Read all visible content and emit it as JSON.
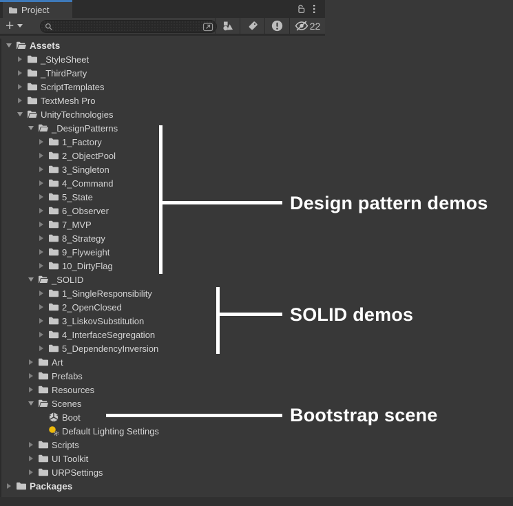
{
  "panel": {
    "tab": {
      "label": "Project",
      "icon": "folder-icon"
    },
    "window_controls": {
      "lock": {
        "icon": "unlocked-padlock-icon",
        "state": "unlocked"
      },
      "menu": {
        "icon": "kebab-menu-icon"
      }
    },
    "toolbar": {
      "create_button_label": "+",
      "search": {
        "value": "",
        "placeholder": "",
        "icon": "search-icon",
        "popout_icon": "open-in-window-icon"
      },
      "filters": [
        {
          "name": "search-by-type",
          "icon": "shapes-icon"
        },
        {
          "name": "search-by-label",
          "icon": "tag-icon"
        },
        {
          "name": "search-by-import-warnings",
          "icon": "exclamation-circle-icon"
        }
      ],
      "hidden_items": {
        "icon": "eye-slash-icon",
        "count": "22"
      }
    }
  },
  "tree": {
    "items": [
      {
        "label": "Assets",
        "level": 0,
        "expander": "expanded",
        "icon": "folder-open-icon",
        "bold": true
      },
      {
        "label": "_StyleSheet",
        "level": 1,
        "expander": "collapsed",
        "icon": "folder-icon"
      },
      {
        "label": "_ThirdParty",
        "level": 1,
        "expander": "collapsed",
        "icon": "folder-icon"
      },
      {
        "label": "ScriptTemplates",
        "level": 1,
        "expander": "collapsed",
        "icon": "folder-icon"
      },
      {
        "label": "TextMesh Pro",
        "level": 1,
        "expander": "collapsed",
        "icon": "folder-icon"
      },
      {
        "label": "UnityTechnologies",
        "level": 1,
        "expander": "expanded",
        "icon": "folder-open-icon"
      },
      {
        "label": "_DesignPatterns",
        "level": 2,
        "expander": "expanded",
        "icon": "folder-open-icon"
      },
      {
        "label": "1_Factory",
        "level": 3,
        "expander": "collapsed",
        "icon": "folder-icon"
      },
      {
        "label": "2_ObjectPool",
        "level": 3,
        "expander": "collapsed",
        "icon": "folder-icon"
      },
      {
        "label": "3_Singleton",
        "level": 3,
        "expander": "collapsed",
        "icon": "folder-icon"
      },
      {
        "label": "4_Command",
        "level": 3,
        "expander": "collapsed",
        "icon": "folder-icon"
      },
      {
        "label": "5_State",
        "level": 3,
        "expander": "collapsed",
        "icon": "folder-icon"
      },
      {
        "label": "6_Observer",
        "level": 3,
        "expander": "collapsed",
        "icon": "folder-icon"
      },
      {
        "label": "7_MVP",
        "level": 3,
        "expander": "collapsed",
        "icon": "folder-icon"
      },
      {
        "label": "8_Strategy",
        "level": 3,
        "expander": "collapsed",
        "icon": "folder-icon"
      },
      {
        "label": "9_Flyweight",
        "level": 3,
        "expander": "collapsed",
        "icon": "folder-icon"
      },
      {
        "label": "10_DirtyFlag",
        "level": 3,
        "expander": "collapsed",
        "icon": "folder-icon"
      },
      {
        "label": "_SOLID",
        "level": 2,
        "expander": "expanded",
        "icon": "folder-open-icon"
      },
      {
        "label": "1_SingleResponsibility",
        "level": 3,
        "expander": "collapsed",
        "icon": "folder-icon"
      },
      {
        "label": "2_OpenClosed",
        "level": 3,
        "expander": "collapsed",
        "icon": "folder-icon"
      },
      {
        "label": "3_LiskovSubstitution",
        "level": 3,
        "expander": "collapsed",
        "icon": "folder-icon"
      },
      {
        "label": "4_InterfaceSegregation",
        "level": 3,
        "expander": "collapsed",
        "icon": "folder-icon"
      },
      {
        "label": "5_DependencyInversion",
        "level": 3,
        "expander": "collapsed",
        "icon": "folder-icon"
      },
      {
        "label": "Art",
        "level": 2,
        "expander": "collapsed",
        "icon": "folder-icon"
      },
      {
        "label": "Prefabs",
        "level": 2,
        "expander": "collapsed",
        "icon": "folder-icon"
      },
      {
        "label": "Resources",
        "level": 2,
        "expander": "collapsed",
        "icon": "folder-icon"
      },
      {
        "label": "Scenes",
        "level": 2,
        "expander": "expanded",
        "icon": "folder-open-icon"
      },
      {
        "label": "Boot",
        "level": 3,
        "expander": "none",
        "icon": "scene-icon"
      },
      {
        "label": "Default Lighting Settings",
        "level": 3,
        "expander": "none",
        "icon": "light-icon"
      },
      {
        "label": "Scripts",
        "level": 2,
        "expander": "collapsed",
        "icon": "folder-icon"
      },
      {
        "label": "UI Toolkit",
        "level": 2,
        "expander": "collapsed",
        "icon": "folder-icon"
      },
      {
        "label": "URPSettings",
        "level": 2,
        "expander": "collapsed",
        "icon": "folder-icon"
      },
      {
        "label": "Packages",
        "level": 0,
        "expander": "collapsed",
        "icon": "folder-icon",
        "bold": true
      }
    ]
  },
  "annotations": {
    "design_patterns": "Design pattern demos",
    "solid": "SOLID demos",
    "bootstrap": "Bootstrap scene"
  },
  "colors": {
    "accent_blue": "#3E79B9",
    "panel_bg": "#383838",
    "tabbar_bg": "#2C2C2C",
    "folder_gray": "#C6C6C6",
    "light_yellow": "#EDB90B",
    "annotation_white": "#FFFFFF"
  }
}
